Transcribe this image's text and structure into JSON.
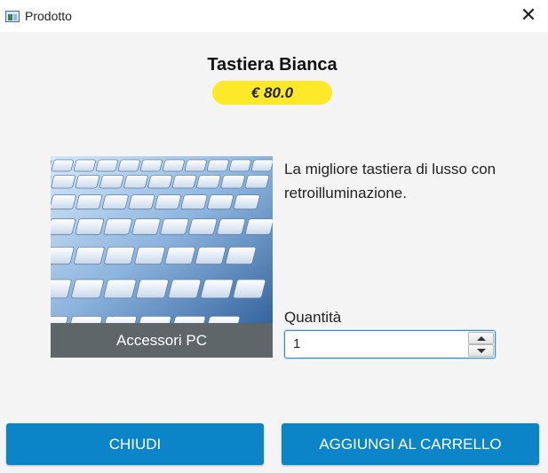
{
  "window": {
    "title": "Prodotto"
  },
  "product": {
    "name": "Tastiera Bianca",
    "price": "€ 80.0",
    "category": "Accessori PC",
    "description": "La migliore tastiera di lusso con retroilluminazione.",
    "image_subject": "keyboard"
  },
  "quantity": {
    "label": "Quantità",
    "value": "1"
  },
  "buttons": {
    "close": "CHIUDI",
    "add_to_cart": "AGGIUNGI AL CARRELLO"
  },
  "colors": {
    "accent": "#0b85c8",
    "price_badge": "#fde829",
    "category_bar": "#5f666a"
  }
}
